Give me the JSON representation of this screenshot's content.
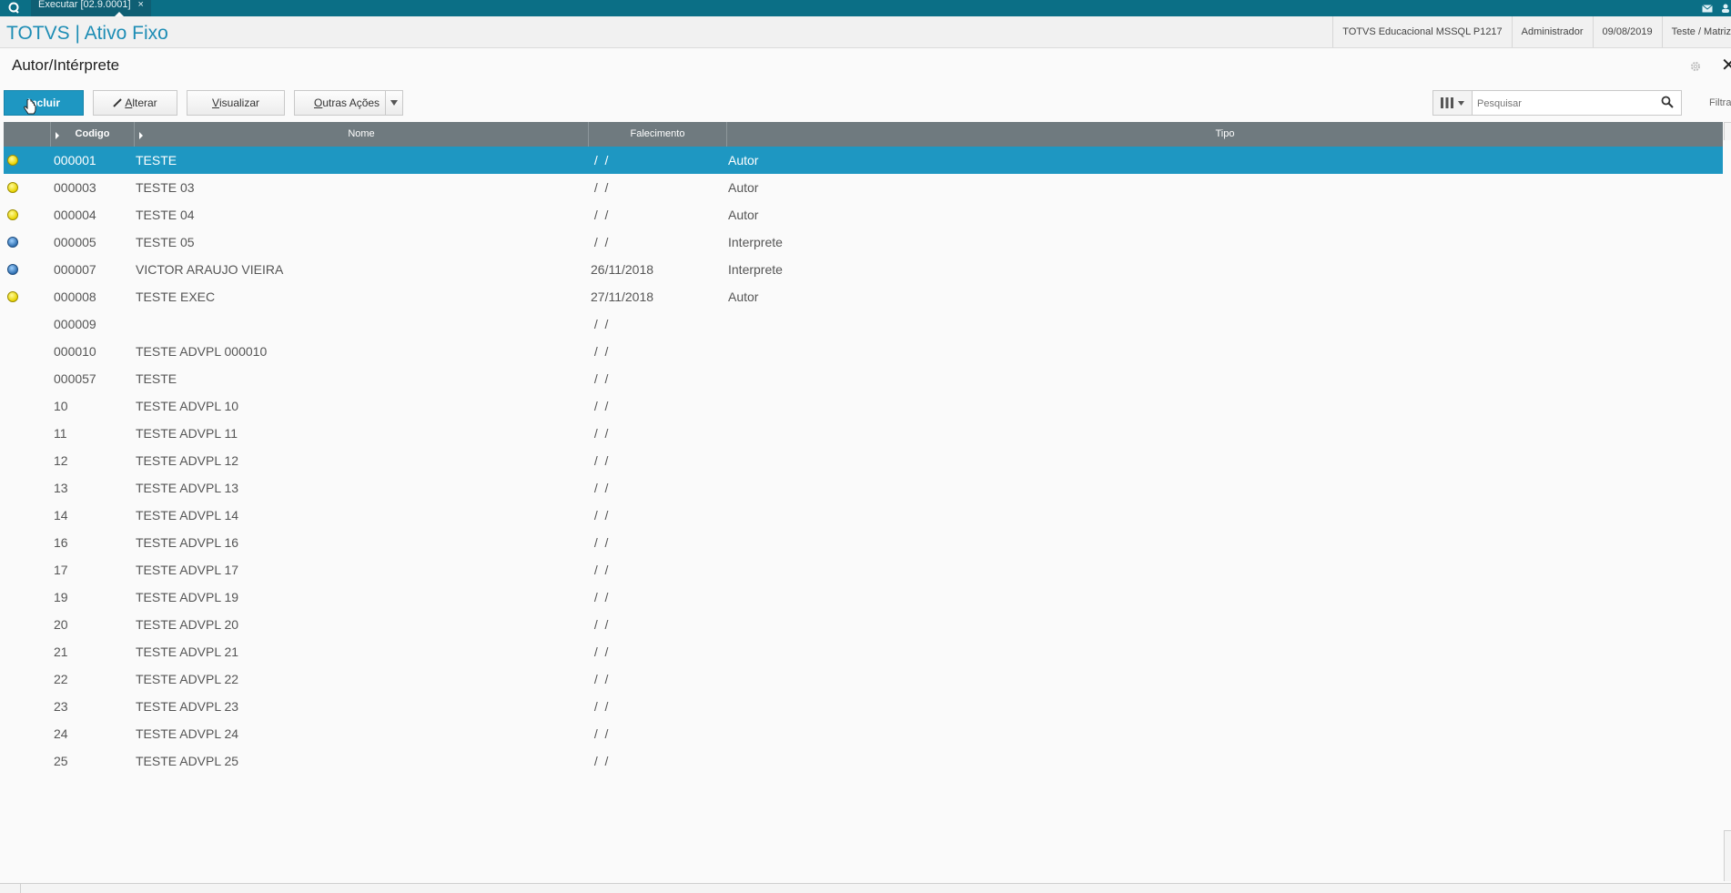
{
  "topbar": {
    "tab_label": "Executar [02.9.0001]",
    "tab_close": "×"
  },
  "header": {
    "brand": "TOTVS | Ativo Fixo",
    "environment": "TOTVS Educacional MSSQL P1217",
    "user": "Administrador",
    "date": "09/08/2019",
    "branch": "Teste / Matriz"
  },
  "page": {
    "title": "Autor/Intérprete"
  },
  "toolbar": {
    "incluir": "Incluir",
    "alterar_first": "A",
    "alterar_rest": "lterar",
    "visualizar_first": "V",
    "visualizar_rest": "isualizar",
    "outras_first": "O",
    "outras_rest": "utras Ações"
  },
  "search": {
    "placeholder": "Pesquisar",
    "filter_label": "Filtrar"
  },
  "grid": {
    "columns": [
      "Codigo",
      "Nome",
      "Falecimento",
      "Tipo"
    ],
    "rows": [
      {
        "status": "yellow",
        "codigo": "000001",
        "nome": "TESTE",
        "falecimento": " /  /",
        "tipo": "Autor"
      },
      {
        "status": "yellow",
        "codigo": "000003",
        "nome": "TESTE 03",
        "falecimento": " /  /",
        "tipo": "Autor"
      },
      {
        "status": "yellow",
        "codigo": "000004",
        "nome": "TESTE 04",
        "falecimento": " /  /",
        "tipo": "Autor"
      },
      {
        "status": "blue",
        "codigo": "000005",
        "nome": "TESTE 05",
        "falecimento": " /  /",
        "tipo": "Interprete"
      },
      {
        "status": "blue",
        "codigo": "000007",
        "nome": "VICTOR ARAUJO VIEIRA",
        "falecimento": "26/11/2018",
        "tipo": "Interprete"
      },
      {
        "status": "yellow",
        "codigo": "000008",
        "nome": "TESTE EXEC",
        "falecimento": "27/11/2018",
        "tipo": "Autor"
      },
      {
        "status": "",
        "codigo": "000009",
        "nome": "",
        "falecimento": " /  /",
        "tipo": ""
      },
      {
        "status": "",
        "codigo": "000010",
        "nome": "TESTE ADVPL 000010",
        "falecimento": " /  /",
        "tipo": ""
      },
      {
        "status": "",
        "codigo": "000057",
        "nome": "TESTE",
        "falecimento": " /  /",
        "tipo": ""
      },
      {
        "status": "",
        "codigo": "10",
        "nome": "TESTE ADVPL 10",
        "falecimento": " /  /",
        "tipo": ""
      },
      {
        "status": "",
        "codigo": "11",
        "nome": "TESTE ADVPL 11",
        "falecimento": " /  /",
        "tipo": ""
      },
      {
        "status": "",
        "codigo": "12",
        "nome": "TESTE ADVPL 12",
        "falecimento": " /  /",
        "tipo": ""
      },
      {
        "status": "",
        "codigo": "13",
        "nome": "TESTE ADVPL 13",
        "falecimento": " /  /",
        "tipo": ""
      },
      {
        "status": "",
        "codigo": "14",
        "nome": "TESTE ADVPL 14",
        "falecimento": " /  /",
        "tipo": ""
      },
      {
        "status": "",
        "codigo": "16",
        "nome": "TESTE ADVPL 16",
        "falecimento": " /  /",
        "tipo": ""
      },
      {
        "status": "",
        "codigo": "17",
        "nome": "TESTE ADVPL 17",
        "falecimento": " /  /",
        "tipo": ""
      },
      {
        "status": "",
        "codigo": "19",
        "nome": "TESTE ADVPL 19",
        "falecimento": " /  /",
        "tipo": ""
      },
      {
        "status": "",
        "codigo": "20",
        "nome": "TESTE ADVPL 20",
        "falecimento": " /  /",
        "tipo": ""
      },
      {
        "status": "",
        "codigo": "21",
        "nome": "TESTE ADVPL 21",
        "falecimento": " /  /",
        "tipo": ""
      },
      {
        "status": "",
        "codigo": "22",
        "nome": "TESTE ADVPL 22",
        "falecimento": " /  /",
        "tipo": ""
      },
      {
        "status": "",
        "codigo": "23",
        "nome": "TESTE ADVPL 23",
        "falecimento": " /  /",
        "tipo": ""
      },
      {
        "status": "",
        "codigo": "24",
        "nome": "TESTE ADVPL 24",
        "falecimento": " /  /",
        "tipo": ""
      },
      {
        "status": "",
        "codigo": "25",
        "nome": "TESTE ADVPL 25",
        "falecimento": " /  /",
        "tipo": ""
      }
    ],
    "selected_index": 0
  },
  "colors": {
    "topbar": "#0b6f86",
    "brand": "#1d8db5",
    "primary_button": "#1e97c2",
    "grid_header": "#6f7a7f",
    "selected_row": "#1e97c2",
    "status_yellow": "#e8d300",
    "status_blue": "#2f6fb0"
  },
  "icons": [
    "totvs-logo-icon",
    "tab-close-icon",
    "mail-icon",
    "user-icon",
    "gear-icon",
    "close-icon",
    "columns-icon",
    "dropdown-arrow-icon",
    "search-icon",
    "pointer-cursor-icon"
  ]
}
